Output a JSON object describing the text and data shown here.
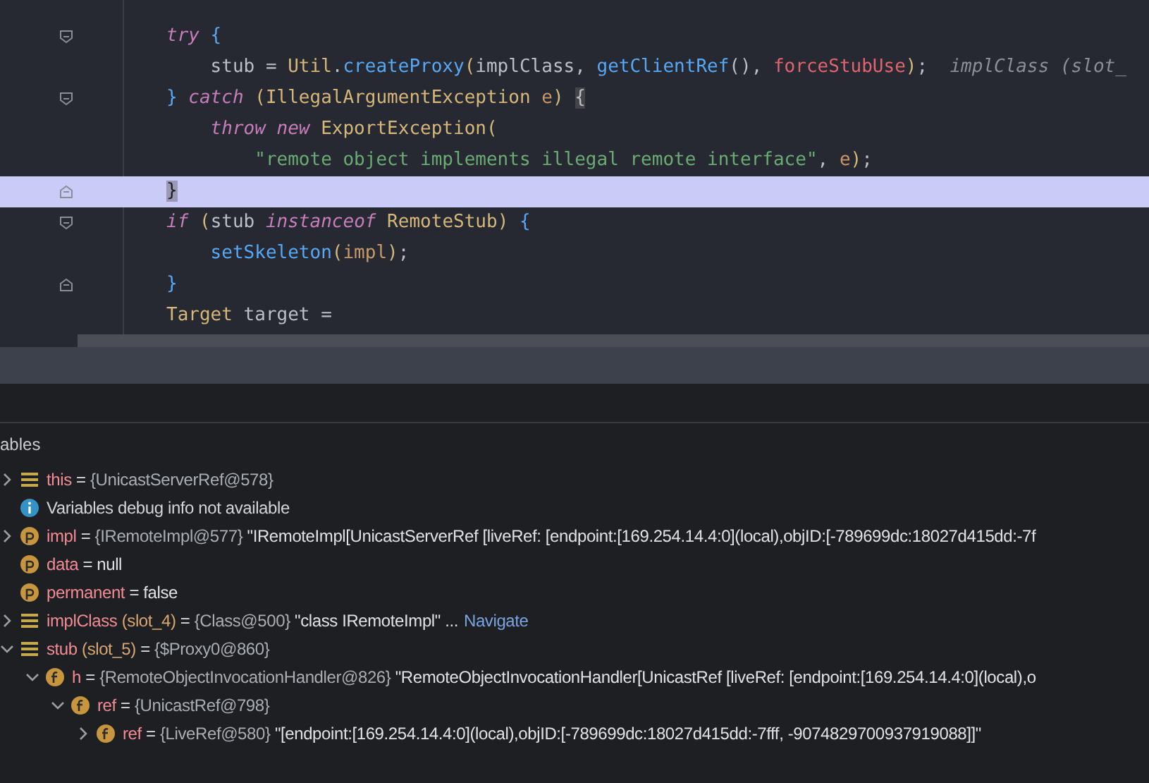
{
  "editor": {
    "lines": [
      {
        "kind": "opener",
        "current": false,
        "tokens": [
          {
            "kind": "kw",
            "text": "try"
          },
          {
            "kind": "brace",
            "text": " {"
          }
        ]
      },
      {
        "kind": "plain",
        "current": false,
        "tokens": [
          {
            "kind": "plain",
            "text": "    stub = "
          },
          {
            "kind": "cls",
            "text": "Util"
          },
          {
            "kind": "plain",
            "text": "."
          },
          {
            "kind": "fn",
            "text": "createProxy"
          },
          {
            "kind": "paren",
            "text": "("
          },
          {
            "kind": "plain",
            "text": "implClass, "
          },
          {
            "kind": "fn",
            "text": "getClientRef"
          },
          {
            "kind": "plain",
            "text": "(), "
          },
          {
            "kind": "field",
            "text": "forceStubUse"
          },
          {
            "kind": "paren",
            "text": ")"
          },
          {
            "kind": "plain",
            "text": ";"
          },
          {
            "kind": "hint",
            "text": "  implClass (slot_"
          }
        ]
      },
      {
        "kind": "opener",
        "current": false,
        "tokens": [
          {
            "kind": "brace",
            "text": "} "
          },
          {
            "kind": "kw",
            "text": "catch"
          },
          {
            "kind": "paren",
            "text": " ("
          },
          {
            "kind": "cls",
            "text": "IllegalArgumentException"
          },
          {
            "kind": "param",
            "text": " e"
          },
          {
            "kind": "paren",
            "text": ") "
          },
          {
            "kind": "match",
            "text": "{"
          }
        ]
      },
      {
        "kind": "plain",
        "current": false,
        "tokens": [
          {
            "kind": "kw",
            "text": "    throw new"
          },
          {
            "kind": "cls",
            "text": " ExportException"
          },
          {
            "kind": "paren",
            "text": "("
          }
        ]
      },
      {
        "kind": "plain",
        "current": false,
        "tokens": [
          {
            "kind": "str",
            "text": "        \"remote object implements illegal remote interface\""
          },
          {
            "kind": "plain",
            "text": ", "
          },
          {
            "kind": "param",
            "text": "e"
          },
          {
            "kind": "paren",
            "text": ")"
          },
          {
            "kind": "plain",
            "text": ";"
          }
        ]
      },
      {
        "kind": "closer",
        "current": true,
        "tokens": [
          {
            "kind": "match",
            "text": "}"
          }
        ]
      },
      {
        "kind": "opener",
        "current": false,
        "tokens": [
          {
            "kind": "kw",
            "text": "if"
          },
          {
            "kind": "paren",
            "text": " ("
          },
          {
            "kind": "plain",
            "text": "stub "
          },
          {
            "kind": "kw",
            "text": "instanceof"
          },
          {
            "kind": "cls",
            "text": " RemoteStub"
          },
          {
            "kind": "paren",
            "text": ")"
          },
          {
            "kind": "brace",
            "text": " {"
          }
        ]
      },
      {
        "kind": "plain",
        "current": false,
        "tokens": [
          {
            "kind": "fn",
            "text": "    setSkeleton"
          },
          {
            "kind": "paren",
            "text": "("
          },
          {
            "kind": "param",
            "text": "impl"
          },
          {
            "kind": "paren",
            "text": ")"
          },
          {
            "kind": "plain",
            "text": ";"
          }
        ]
      },
      {
        "kind": "closer",
        "current": false,
        "tokens": [
          {
            "kind": "brace",
            "text": "}"
          }
        ]
      },
      {
        "kind": "plain",
        "current": false,
        "tokens": [
          {
            "kind": "cls",
            "text": "Target"
          },
          {
            "kind": "plain",
            "text": " target ="
          }
        ]
      }
    ]
  },
  "variables": {
    "title": "ables",
    "items": [
      {
        "kind": "local",
        "expanded": false,
        "name": "this",
        "sep": "=",
        "type": "{UnicastServerRef@578}"
      },
      {
        "kind": "info",
        "message": "Variables debug info not available"
      },
      {
        "kind": "param",
        "expanded": false,
        "name": "impl",
        "sep": "=",
        "type": "{IRemoteImpl@577}",
        "value": "\"IRemoteImpl[UnicastServerRef [liveRef: [endpoint:[169.254.14.4:0](local),objID:[-789699dc:18027d415dd:-7f"
      },
      {
        "kind": "param",
        "name": "data",
        "sep": "=",
        "value": "null"
      },
      {
        "kind": "param",
        "name": "permanent",
        "sep": "=",
        "value": "false"
      },
      {
        "kind": "local",
        "expanded": false,
        "name": "implClass",
        "slot": "(slot_4)",
        "sep": "=",
        "type": "{Class@500}",
        "value": "\"class IRemoteImpl\" ...",
        "link": "Navigate"
      },
      {
        "kind": "local",
        "expanded": true,
        "name": "stub",
        "slot": "(slot_5)",
        "sep": "=",
        "type": "{$Proxy0@860}",
        "children": [
          {
            "kind": "field",
            "expanded": true,
            "name": "h",
            "sep": "=",
            "type": "{RemoteObjectInvocationHandler@826}",
            "value": "\"RemoteObjectInvocationHandler[UnicastRef [liveRef: [endpoint:[169.254.14.4:0](local),o",
            "children": [
              {
                "kind": "field",
                "expanded": true,
                "name": "ref",
                "sep": "=",
                "type": "{UnicastRef@798}",
                "children": [
                  {
                    "kind": "field",
                    "expanded": false,
                    "name": "ref",
                    "sep": "=",
                    "type": "{LiveRef@580}",
                    "value": "\"[endpoint:[169.254.14.4:0](local),objID:[-789699dc:18027d415dd:-7fff, -9074829700937919088]]\""
                  }
                ]
              }
            ]
          }
        ]
      }
    ]
  }
}
